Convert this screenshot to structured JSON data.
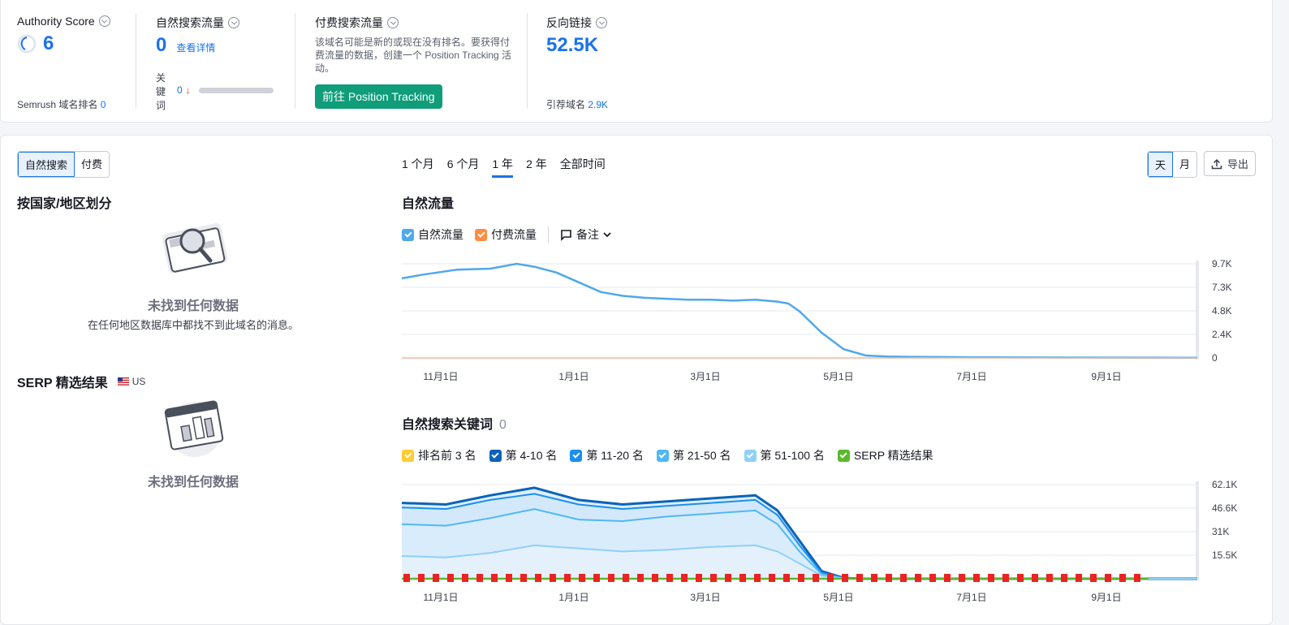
{
  "metrics": {
    "authority": {
      "title": "Authority Score",
      "value": "6",
      "rank_label": "Semrush 域名排名",
      "rank_value": "0"
    },
    "organic": {
      "title": "自然搜索流量",
      "value": "0",
      "details_link": "查看详情",
      "keywords_label": "关\n键\n词",
      "keywords_value": "0"
    },
    "paid": {
      "title": "付费搜索流量",
      "desc": "该域名可能是新的或现在没有排名。要获得付费流量的数据，创建一个 Position Tracking 活动。",
      "button": "前往 Position Tracking"
    },
    "backlinks": {
      "title": "反向链接",
      "value": "52.5K",
      "ref_label": "引荐域名",
      "ref_value": "2.9K"
    }
  },
  "tabs": {
    "organic": "自然搜索",
    "paid": "付费"
  },
  "periods": [
    "1 个月",
    "6 个月",
    "1 年",
    "2 年",
    "全部时间"
  ],
  "active_period": "1 年",
  "granularity": {
    "day": "天",
    "month": "月"
  },
  "export": "导出",
  "left": {
    "country_title": "按国家/地区划分",
    "country_empty_title": "未找到任何数据",
    "country_empty_sub": "在任何地区数据库中都找不到此域名的消息。",
    "serp_title": "SERP 精选结果",
    "serp_region": "US",
    "serp_empty_title": "未找到任何数据"
  },
  "traffic": {
    "title": "自然流量",
    "legend": {
      "organic": "自然流量",
      "paid": "付费流量",
      "notes": "备注"
    },
    "colors": {
      "organic": "#4ea8ec",
      "paid": "#ff8c42"
    }
  },
  "keywords": {
    "title": "自然搜索关键词",
    "count": "0",
    "legend": [
      {
        "label": "排名前 3 名",
        "color": "#ffcc33"
      },
      {
        "label": "第 4-10 名",
        "color": "#0a63b8"
      },
      {
        "label": "第 11-20 名",
        "color": "#1a8ff0"
      },
      {
        "label": "第 21-50 名",
        "color": "#4fb8f5"
      },
      {
        "label": "第 51-100 名",
        "color": "#8fd0f8"
      },
      {
        "label": "SERP 精选结果",
        "color": "#5cb82e"
      }
    ]
  },
  "chart_data": [
    {
      "type": "line",
      "title": "自然流量",
      "x_ticks": [
        "11月1日",
        "1月1日",
        "3月1日",
        "5月1日",
        "7月1日",
        "9月1日"
      ],
      "y_ticks": [
        "9.7K",
        "7.3K",
        "4.8K",
        "2.4K",
        "0"
      ],
      "ylim": [
        0,
        9700
      ],
      "series": [
        {
          "name": "自然流量",
          "x_days": [
            0,
            10,
            25,
            40,
            52,
            60,
            70,
            80,
            90,
            100,
            110,
            120,
            130,
            140,
            150,
            160,
            170,
            175,
            180,
            190,
            200,
            210,
            220,
            230,
            240,
            250,
            260,
            270,
            280,
            300,
            330,
            360
          ],
          "values": [
            8200,
            8600,
            9100,
            9200,
            9700,
            9400,
            8800,
            7800,
            6800,
            6400,
            6200,
            6100,
            6000,
            6000,
            5900,
            6000,
            5800,
            5600,
            4800,
            2600,
            900,
            250,
            150,
            120,
            100,
            80,
            70,
            60,
            50,
            40,
            30,
            20
          ]
        },
        {
          "name": "付费流量",
          "x_days": [
            0,
            360
          ],
          "values": [
            0,
            0
          ]
        }
      ]
    },
    {
      "type": "area",
      "title": "自然搜索关键词",
      "x_ticks": [
        "11月1日",
        "1月1日",
        "3月1日",
        "5月1日",
        "7月1日",
        "9月1日"
      ],
      "y_ticks": [
        "62.1K",
        "46.6K",
        "31K",
        "15.5K"
      ],
      "ylim": [
        0,
        62100
      ],
      "x_days": [
        0,
        20,
        40,
        60,
        80,
        100,
        120,
        140,
        160,
        170,
        180,
        190,
        200,
        210,
        220,
        360
      ],
      "series": [
        {
          "name": "第 4-10 名",
          "values": [
            50000,
            49000,
            55000,
            60000,
            52000,
            49000,
            51000,
            53000,
            55000,
            45000,
            25000,
            5000,
            500,
            0,
            0,
            0
          ]
        },
        {
          "name": "第 11-20 名",
          "values": [
            47000,
            46000,
            52000,
            56000,
            49000,
            46000,
            48000,
            50000,
            52000,
            42000,
            22000,
            4000,
            400,
            0,
            0,
            0
          ]
        },
        {
          "name": "第 21-50 名",
          "values": [
            36000,
            35000,
            40000,
            46000,
            39000,
            38000,
            41000,
            43000,
            45000,
            36000,
            18000,
            3000,
            300,
            0,
            0,
            0
          ]
        },
        {
          "name": "第 51-100 名",
          "values": [
            15000,
            14000,
            17000,
            22000,
            20000,
            18000,
            19000,
            21000,
            22000,
            18000,
            10000,
            2000,
            200,
            0,
            0,
            0
          ]
        }
      ]
    }
  ]
}
